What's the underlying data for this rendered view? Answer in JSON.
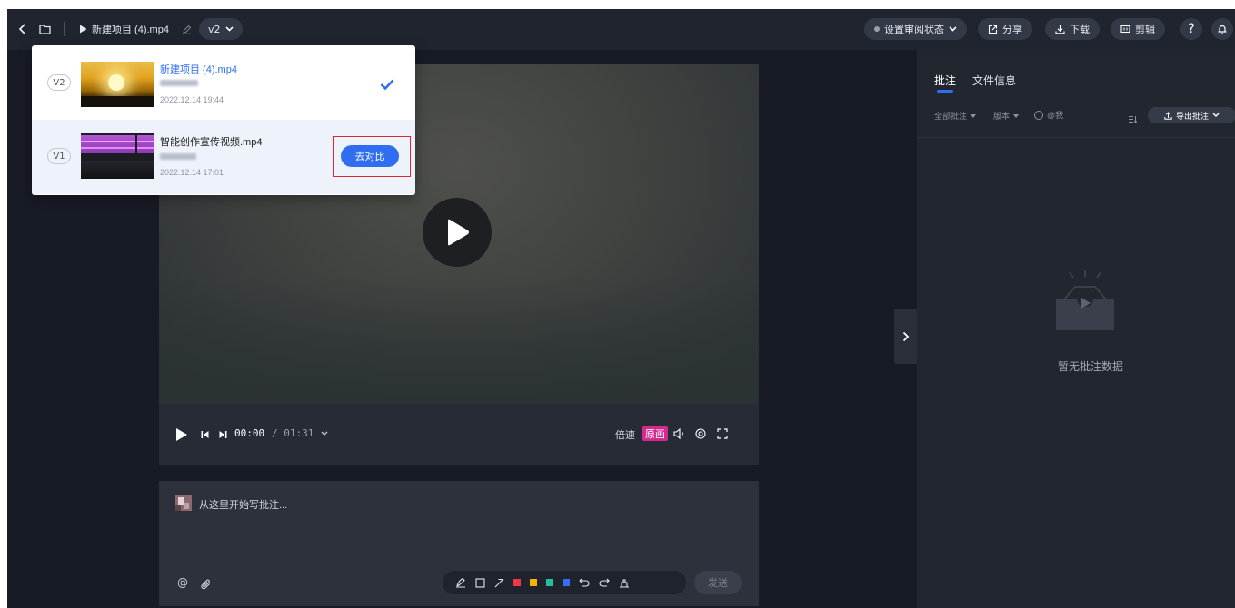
{
  "topbar": {
    "project_title": "新建项目 (4).mp4",
    "version_select": "v2",
    "review_status": "设置审阅状态",
    "share": "分享",
    "download": "下载",
    "edit": "剪辑",
    "help": "?"
  },
  "player": {
    "current_time": "00:00",
    "total_time": "/ 01:31",
    "speed_label": "倍速",
    "quality_label": "原画"
  },
  "comment_box": {
    "placeholder": "从这里开始写批注...",
    "send": "发送",
    "colors": [
      "#f0364a",
      "#f5b400",
      "#20c1a0",
      "#3c6cf5"
    ]
  },
  "right_panel": {
    "tabs": [
      "批注",
      "文件信息"
    ],
    "filters": {
      "all": "全部批注",
      "version": "版本",
      "mention": "@我"
    },
    "export": "导出批注",
    "empty_text": "暂无批注数据"
  },
  "versions": [
    {
      "tag": "V2",
      "filename": "新建项目 (4).mp4",
      "date": "2022.12.14 19:44",
      "selected": true
    },
    {
      "tag": "V1",
      "filename": "智能创作宣传视频.mp4",
      "date": "2022.12.14 17:01",
      "compare_label": "去对比"
    }
  ],
  "accent_color": "#2f6ef0"
}
